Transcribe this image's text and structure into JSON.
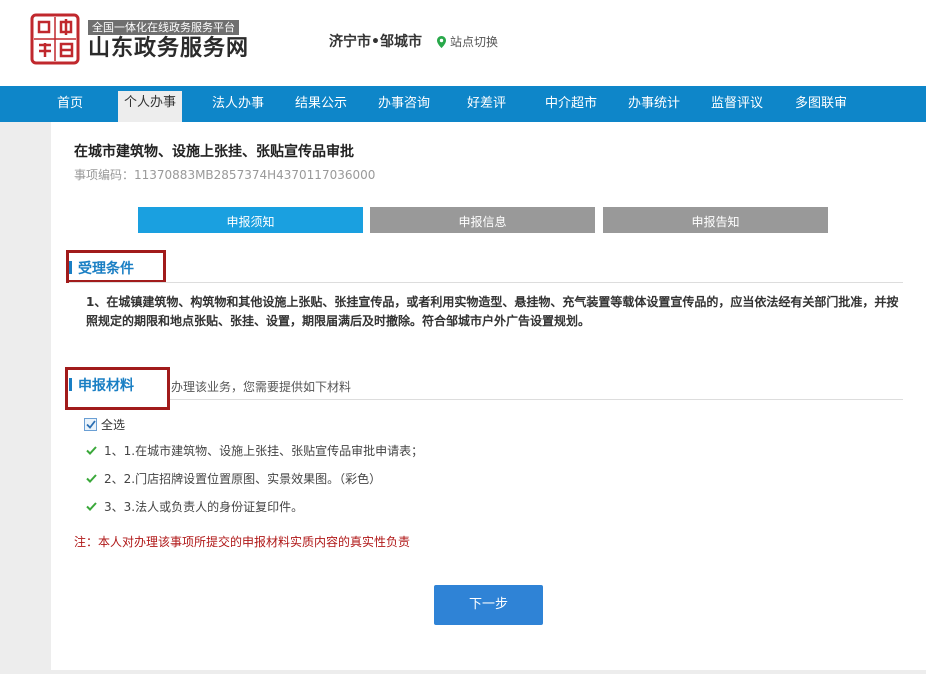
{
  "header": {
    "platform_tag": "全国一体化在线政务服务平台",
    "site_name": "山东政务服务网",
    "city": "济宁市•邹城市",
    "switch_label": "站点切换"
  },
  "nav": {
    "items": [
      "首页",
      "个人办事",
      "法人办事",
      "结果公示",
      "办事咨询",
      "好差评",
      "中介超市",
      "办事统计",
      "监督评议",
      "多图联审"
    ],
    "active": "个人办事"
  },
  "item": {
    "title": "在城市建筑物、设施上张挂、张贴宣传品审批",
    "code": "事项编码：11370883MB2857374H4370117036000"
  },
  "tabs": [
    "申报须知",
    "申报信息",
    "申报告知"
  ],
  "conditions": {
    "heading": "受理条件",
    "text": "1、在城镇建筑物、构筑物和其他设施上张贴、张挂宣传品，或者利用实物造型、悬挂物、充气装置等载体设置宣传品的，应当依法经有关部门批准，并按照规定的期限和地点张贴、张挂、设置，期限届满后及时撤除。符合邹城市户外广告设置规划。"
  },
  "materials": {
    "heading": "申报材料",
    "hint": "办理该业务，您需要提供如下材料",
    "select_all": "全选",
    "items": [
      "1、1.在城市建筑物、设施上张挂、张贴宣传品审批申请表；",
      "2、2.门店招牌设置位置原图、实景效果图。（彩色）",
      "3、3.法人或负责人的身份证复印件。"
    ]
  },
  "note": "注：本人对办理该事项所提交的申报材料实质内容的真实性负责",
  "next_button": "下一步",
  "colors": {
    "nav_blue": "#0e86c9",
    "tab_active": "#1aa0e0",
    "tab_inactive": "#999999",
    "highlight_red": "#a11b1b",
    "check_green": "#3aa83a",
    "button_blue": "#2f83d6"
  }
}
